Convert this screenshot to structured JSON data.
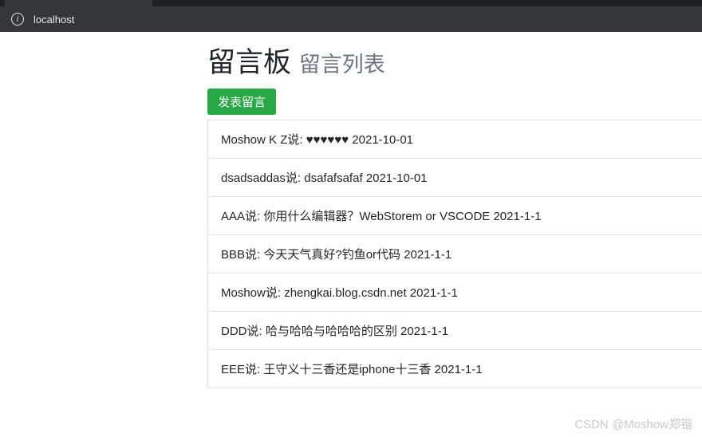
{
  "browser": {
    "url_label": "localhost"
  },
  "header": {
    "title": "留言板",
    "subtitle": "留言列表"
  },
  "actions": {
    "post_label": "发表留言"
  },
  "messages": [
    {
      "author": "Moshow K Z",
      "verb": "说",
      "content": "♥♥♥♥♥♥",
      "date": "2021-10-01"
    },
    {
      "author": "dsadsaddas",
      "verb": "说",
      "content": "dsafafsafaf",
      "date": "2021-10-01"
    },
    {
      "author": "AAA",
      "verb": "说",
      "content": "你用什么编辑器？WebStorem or VSCODE",
      "date": "2021-1-1"
    },
    {
      "author": "BBB",
      "verb": "说",
      "content": "今天天气真好?钓鱼or代码",
      "date": "2021-1-1"
    },
    {
      "author": "Moshow",
      "verb": "说",
      "content": "zhengkai.blog.csdn.net",
      "date": "2021-1-1"
    },
    {
      "author": "DDD",
      "verb": "说",
      "content": "哈与哈哈与哈哈哈的区别",
      "date": "2021-1-1"
    },
    {
      "author": "EEE",
      "verb": "说",
      "content": "王守义十三香还是iphone十三香",
      "date": "2021-1-1"
    }
  ],
  "watermark": "CSDN @Moshow郑锴"
}
